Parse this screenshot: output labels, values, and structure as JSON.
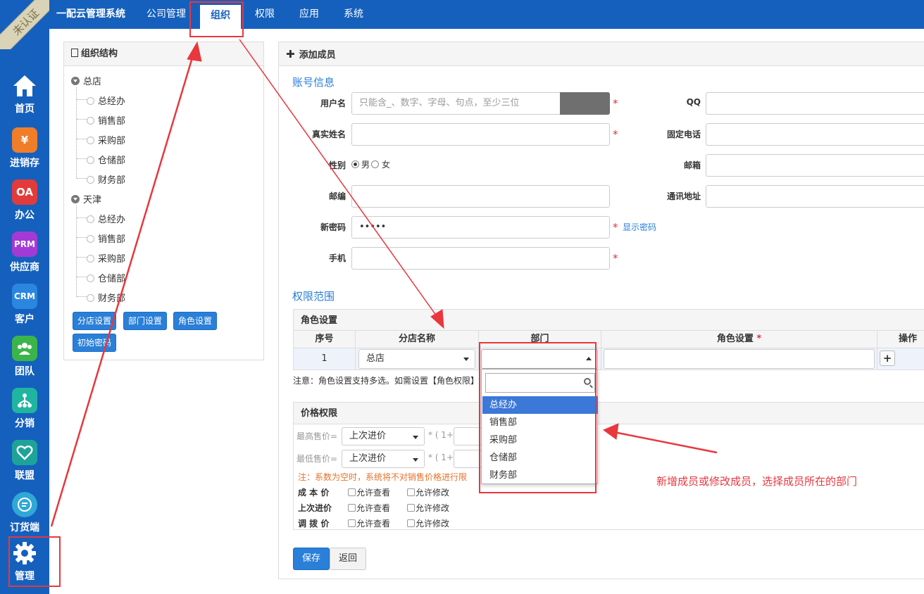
{
  "badge": "未认证",
  "sidebar": {
    "items": [
      {
        "label": "首页",
        "icon": "home-icon"
      },
      {
        "label": "进销存",
        "icon": "yen-icon",
        "glyph": "¥",
        "color": "#f07d2a"
      },
      {
        "label": "办公",
        "icon": "oa-icon",
        "glyph": "OA",
        "color": "#e23b3b"
      },
      {
        "label": "供应商",
        "icon": "prm-icon",
        "glyph": "PRM",
        "color": "#a43ad6"
      },
      {
        "label": "客户",
        "icon": "crm-icon",
        "glyph": "CRM",
        "color": "#2b86e0"
      },
      {
        "label": "团队",
        "icon": "team-icon",
        "color": "#3bb54a"
      },
      {
        "label": "分销",
        "icon": "distribution-icon",
        "color": "#1fb5a0"
      },
      {
        "label": "联盟",
        "icon": "alliance-icon",
        "color": "#1ea39a"
      },
      {
        "label": "订货端",
        "icon": "order-icon",
        "color": "#2fa8d8"
      },
      {
        "label": "管理",
        "icon": "gear-icon"
      }
    ]
  },
  "topnav": {
    "brand": "一配云管理系统",
    "items": [
      "公司管理",
      "组织",
      "权限",
      "应用",
      "系统"
    ]
  },
  "org": {
    "title": "组织结构",
    "branches": [
      {
        "name": "总店",
        "depts": [
          "总经办",
          "销售部",
          "采购部",
          "仓储部",
          "财务部"
        ]
      },
      {
        "name": "天津",
        "depts": [
          "总经办",
          "销售部",
          "采购部",
          "仓储部",
          "财务部"
        ]
      }
    ],
    "buttons": [
      "分店设置",
      "部门设置",
      "角色设置",
      "初始密码"
    ]
  },
  "member": {
    "title": "添加成员",
    "account_section": "账号信息",
    "labels": {
      "username": "用户名",
      "realname": "真实姓名",
      "gender": "性别",
      "zipcode": "邮编",
      "password": "新密码",
      "mobile": "手机",
      "qq": "QQ",
      "phone": "固定电话",
      "email": "邮箱",
      "address": "通讯地址"
    },
    "username_placeholder": "只能含_、数字、字母、句点，至少三位",
    "gender_male": "男",
    "gender_female": "女",
    "password_value": "•••••",
    "show_password": "显示密码"
  },
  "permission": {
    "section": "权限范围",
    "role_panel": "角色设置",
    "headers": [
      "序号",
      "分店名称",
      "部门",
      "角色设置",
      "操作"
    ],
    "row": {
      "index": "1",
      "branch": "总店"
    },
    "note": "注意：角色设置支持多选。如需设置【角色权限】",
    "dept_options": [
      "总经办",
      "销售部",
      "采购部",
      "仓储部",
      "财务部"
    ]
  },
  "price": {
    "title": "价格权限",
    "max_label": "最高售价=",
    "min_label": "最低售价=",
    "select_value": "上次进价",
    "formula": "* ( 1+",
    "note": "注：系数为空时，系统将不对销售价格进行限",
    "rows": [
      "成 本 价",
      "上次进价",
      "调 拨 价"
    ],
    "allow_view": "允许查看",
    "allow_edit": "允许修改"
  },
  "actions": {
    "save": "保存",
    "back": "返回"
  },
  "annotation": "新增成员或修改成员，选择成员所在的部门",
  "colors": {
    "brand": "#1560bd",
    "accent": "#2a7fd8",
    "annotation": "#e8373d"
  }
}
